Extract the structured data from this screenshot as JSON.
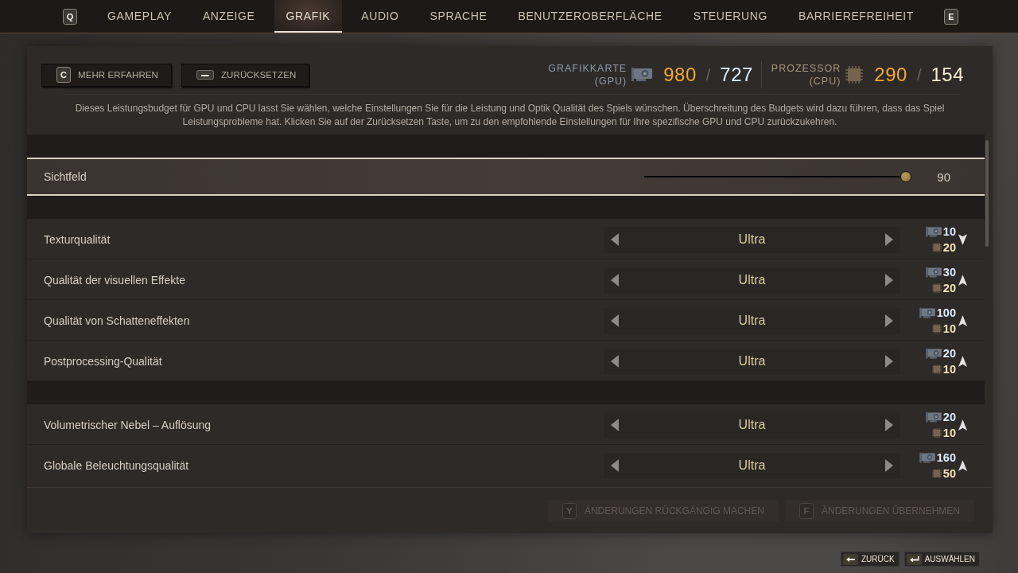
{
  "tabs": {
    "prev_key": "Q",
    "next_key": "E",
    "items": [
      {
        "label": "GAMEPLAY",
        "selected": false
      },
      {
        "label": "ANZEIGE",
        "selected": false
      },
      {
        "label": "GRAFIK",
        "selected": true
      },
      {
        "label": "AUDIO",
        "selected": false
      },
      {
        "label": "SPRACHE",
        "selected": false
      },
      {
        "label": "BENUTZEROBERFLÄCHE",
        "selected": false
      },
      {
        "label": "STEUERUNG",
        "selected": false
      },
      {
        "label": "BARRIEREFREIHEIT",
        "selected": false
      }
    ]
  },
  "header": {
    "buttons": [
      {
        "kind": "key",
        "key": "C",
        "label": "MEHR ERFAHREN"
      },
      {
        "kind": "spacebar",
        "label": "ZURÜCKSETZEN"
      }
    ],
    "budget": [
      {
        "kind": "gpu",
        "label": "GRAFIKKARTE",
        "sublabel": "(GPU)",
        "used": "980",
        "separator": "/",
        "available": "727"
      },
      {
        "kind": "cpu",
        "label": "PROZESSOR",
        "sublabel": "(CPU)",
        "used": "290",
        "separator": "/",
        "available": "154"
      }
    ]
  },
  "description": "Dieses Leistungsbudget für GPU und CPU lasst Sie wählen, welche Einstellungen Sie für die Leistung und Optik Qualität des Spiels wünschen. Überschreitung des Budgets wird dazu führen, dass das Spiel Leistungsprobleme hat. Klicken Sie auf der Zurücksetzen Taste, um zu den empfohlende Einstellungen für Ihre spezifische GPU und CPU zurückzukehren.",
  "sections": [
    {
      "rows": [
        {
          "kind": "slider",
          "label": "Sichtfeld",
          "level": 1,
          "reading": "90",
          "selected": true
        }
      ]
    },
    {
      "rows": [
        {
          "kind": "choice",
          "label": "Texturqualität",
          "value": "Ultra",
          "gpu_cost": "10",
          "cpu_cost": "20",
          "increase": false,
          "selected": false
        },
        {
          "kind": "choice",
          "label": "Qualität der visuellen Effekte",
          "value": "Ultra",
          "gpu_cost": "30",
          "cpu_cost": "20",
          "increase": true,
          "selected": false
        },
        {
          "kind": "choice",
          "label": "Qualität von Schatteneffekten",
          "value": "Ultra",
          "gpu_cost": "100",
          "cpu_cost": "10",
          "increase": true,
          "selected": false
        },
        {
          "kind": "choice",
          "label": "Postprocessing-Qualität",
          "value": "Ultra",
          "gpu_cost": "20",
          "cpu_cost": "10",
          "increase": true,
          "selected": false
        }
      ]
    },
    {
      "rows": [
        {
          "kind": "choice",
          "label": "Volumetrischer Nebel – Auflösung",
          "value": "Ultra",
          "gpu_cost": "20",
          "cpu_cost": "10",
          "increase": true,
          "selected": false
        },
        {
          "kind": "choice",
          "label": "Globale Beleuchtungsqualität",
          "value": "Ultra",
          "gpu_cost": "160",
          "cpu_cost": "50",
          "increase": true,
          "selected": false
        }
      ]
    }
  ],
  "footer": {
    "buttons": [
      {
        "key": "Y",
        "label": "ÄNDERUNGEN RÜCKGÄNGIG MACHEN",
        "disabled": true
      },
      {
        "key": "F",
        "label": "ÄNDERUNGEN ÜBERNEHMEN",
        "disabled": true
      }
    ]
  },
  "hints": [
    {
      "kind": "back",
      "label": "ZURÜCK"
    },
    {
      "kind": "enter",
      "label": "AUSWÄHLEN"
    }
  ]
}
